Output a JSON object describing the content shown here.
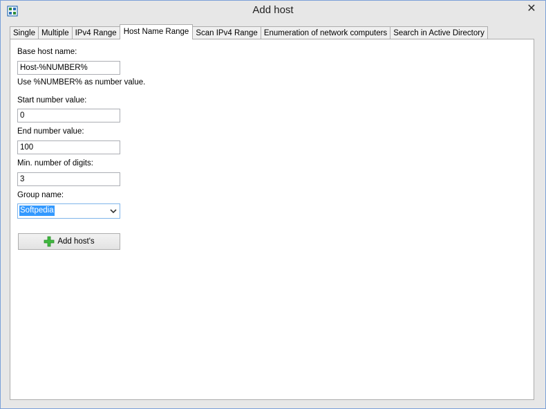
{
  "window": {
    "title": "Add host",
    "close_glyph": "✕",
    "app_icon": "network-app-icon",
    "close_icon": "close-icon"
  },
  "tabs": [
    {
      "label": "Single",
      "active": false
    },
    {
      "label": "Multiple",
      "active": false
    },
    {
      "label": "IPv4 Range",
      "active": false
    },
    {
      "label": "Host Name Range",
      "active": true
    },
    {
      "label": "Scan IPv4 Range",
      "active": false
    },
    {
      "label": "Enumeration of network computers",
      "active": false
    },
    {
      "label": "Search in Active Directory",
      "active": false
    }
  ],
  "form": {
    "base_host_name_label": "Base host name:",
    "base_host_name_value": "Host-%NUMBER%",
    "hint": "Use %NUMBER% as number value.",
    "start_label": "Start number value:",
    "start_value": "0",
    "end_label": "End number value:",
    "end_value": "100",
    "digits_label": "Min. number of digits:",
    "digits_value": "3",
    "group_label": "Group name:",
    "group_value": "Softpedia",
    "add_button_label": "Add host's",
    "add_icon": "plus-icon",
    "dropdown_icon": "chevron-down-icon"
  },
  "colors": {
    "selection": "#3399ff",
    "plus_green": "#3fb93f",
    "window_border": "#7aa0d8"
  }
}
